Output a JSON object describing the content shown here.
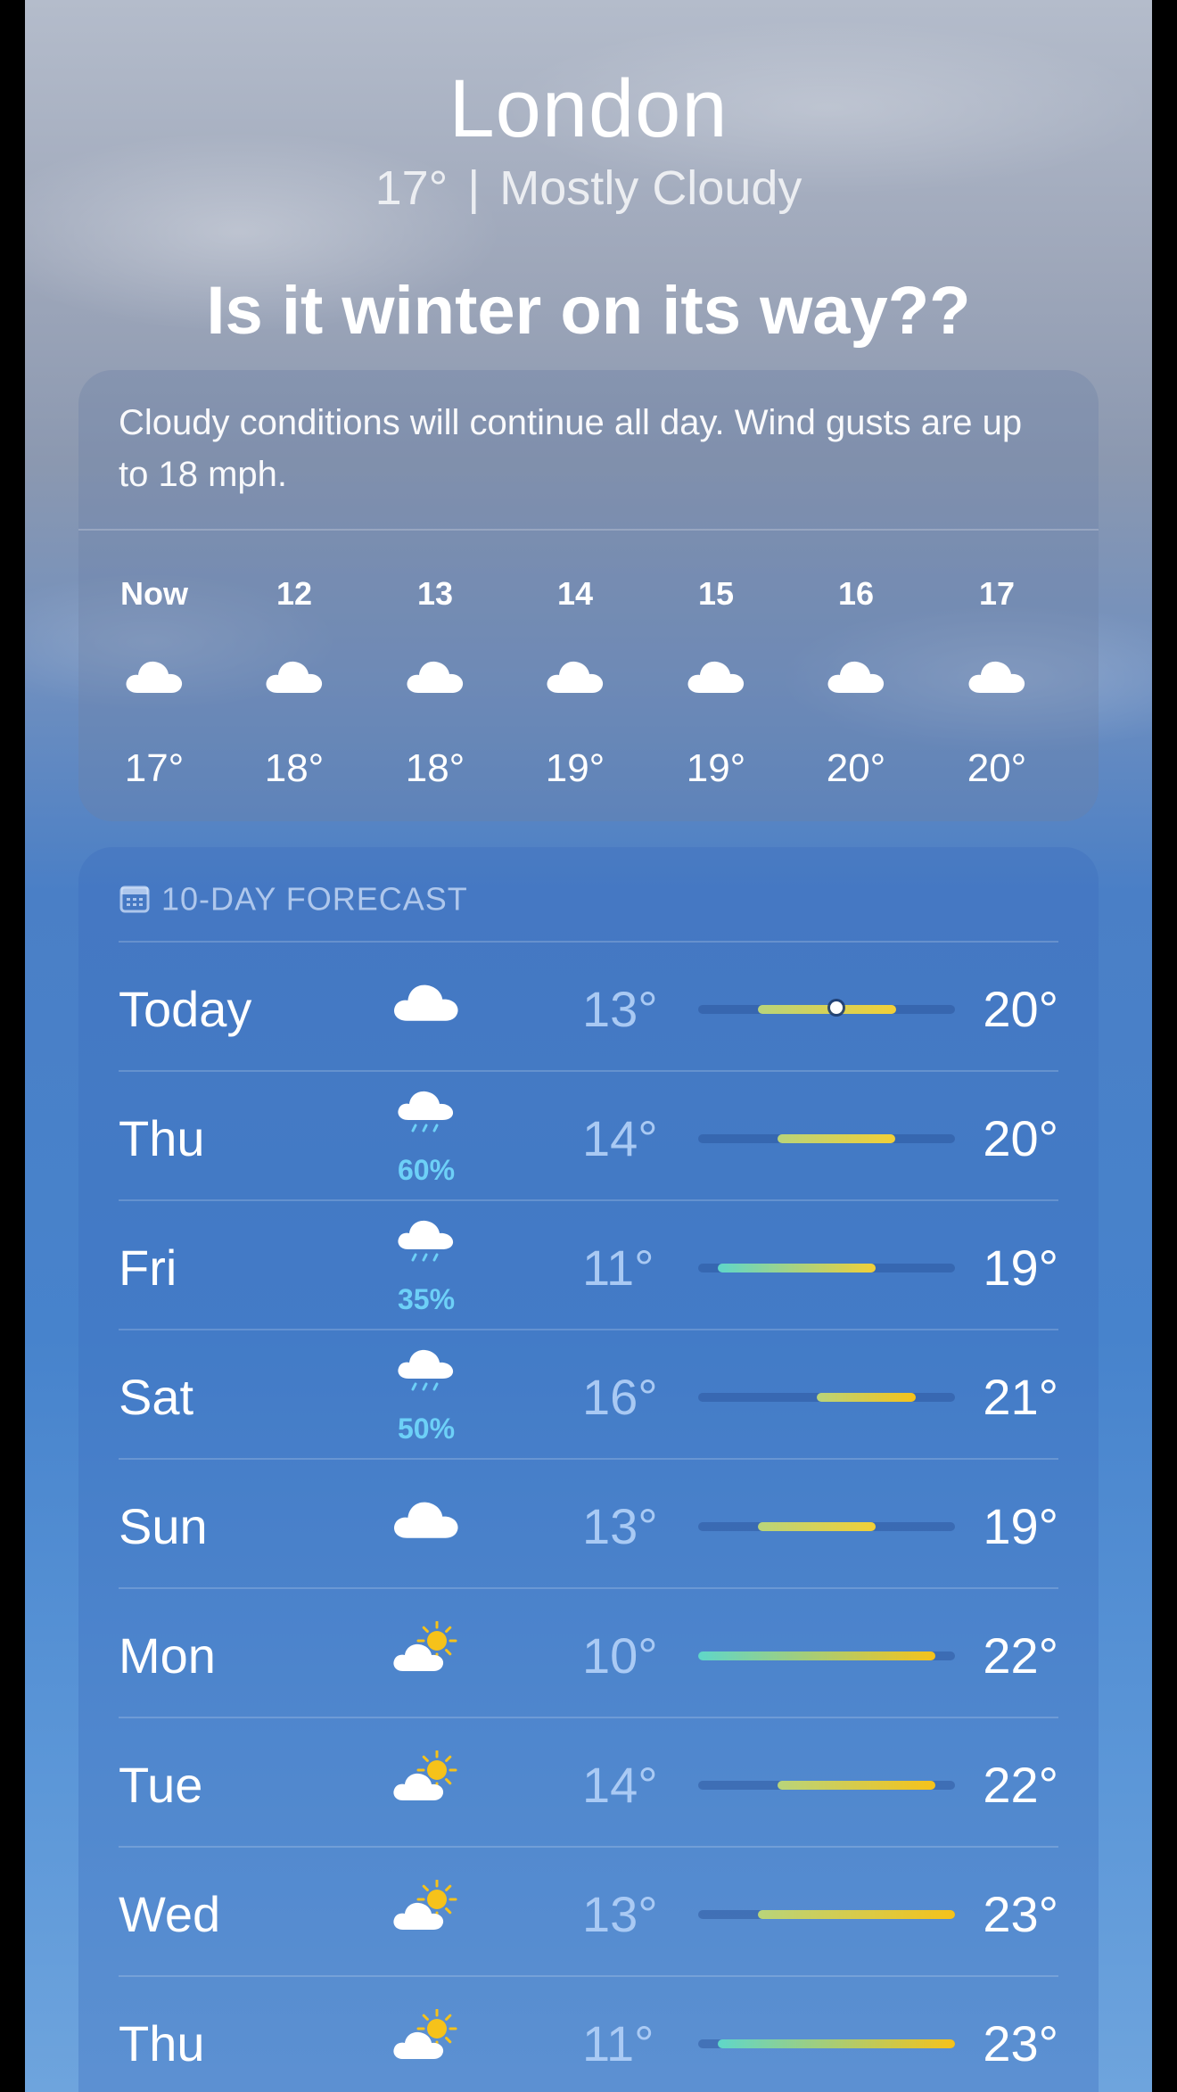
{
  "header": {
    "city": "London",
    "current_temp": "17°",
    "separator": "|",
    "condition": "Mostly Cloudy",
    "headline": "Is it winter on its way??"
  },
  "hourly": {
    "summary": "Cloudy conditions will continue all day. Wind gusts are up to 18 mph.",
    "hours": [
      {
        "label": "Now",
        "icon": "cloud-icon",
        "temp": "17°"
      },
      {
        "label": "12",
        "icon": "cloud-icon",
        "temp": "18°"
      },
      {
        "label": "13",
        "icon": "cloud-icon",
        "temp": "18°"
      },
      {
        "label": "14",
        "icon": "cloud-icon",
        "temp": "19°"
      },
      {
        "label": "15",
        "icon": "cloud-icon",
        "temp": "19°"
      },
      {
        "label": "16",
        "icon": "cloud-icon",
        "temp": "20°"
      },
      {
        "label": "17",
        "icon": "cloud-icon",
        "temp": "20°"
      }
    ]
  },
  "forecast": {
    "title": "10-DAY FORECAST",
    "icon": "calendar-icon",
    "range_min": 10,
    "range_max": 23,
    "current_temp_value": 17,
    "days": [
      {
        "day": "Today",
        "icon": "cloud-icon",
        "precip": "",
        "low": "13°",
        "high": "20°",
        "low_val": 13,
        "high_val": 20
      },
      {
        "day": "Thu",
        "icon": "cloud-rain-icon",
        "precip": "60%",
        "low": "14°",
        "high": "20°",
        "low_val": 14,
        "high_val": 20
      },
      {
        "day": "Fri",
        "icon": "cloud-rain-icon",
        "precip": "35%",
        "low": "11°",
        "high": "19°",
        "low_val": 11,
        "high_val": 19
      },
      {
        "day": "Sat",
        "icon": "cloud-rain-icon",
        "precip": "50%",
        "low": "16°",
        "high": "21°",
        "low_val": 16,
        "high_val": 21
      },
      {
        "day": "Sun",
        "icon": "cloud-icon",
        "precip": "",
        "low": "13°",
        "high": "19°",
        "low_val": 13,
        "high_val": 19
      },
      {
        "day": "Mon",
        "icon": "partly-cloudy-sun-icon",
        "precip": "",
        "low": "10°",
        "high": "22°",
        "low_val": 10,
        "high_val": 22
      },
      {
        "day": "Tue",
        "icon": "partly-cloudy-sun-icon",
        "precip": "",
        "low": "14°",
        "high": "22°",
        "low_val": 14,
        "high_val": 22
      },
      {
        "day": "Wed",
        "icon": "partly-cloudy-sun-icon",
        "precip": "",
        "low": "13°",
        "high": "23°",
        "low_val": 13,
        "high_val": 23
      },
      {
        "day": "Thu",
        "icon": "partly-cloudy-sun-icon",
        "precip": "",
        "low": "11°",
        "high": "23°",
        "low_val": 11,
        "high_val": 23
      }
    ]
  },
  "colors": {
    "cool": "#5fd6c9",
    "mild": "#b9d47a",
    "warm": "#f2cf37",
    "hot": "#f6c21a",
    "precip": "#6dd0f7"
  }
}
